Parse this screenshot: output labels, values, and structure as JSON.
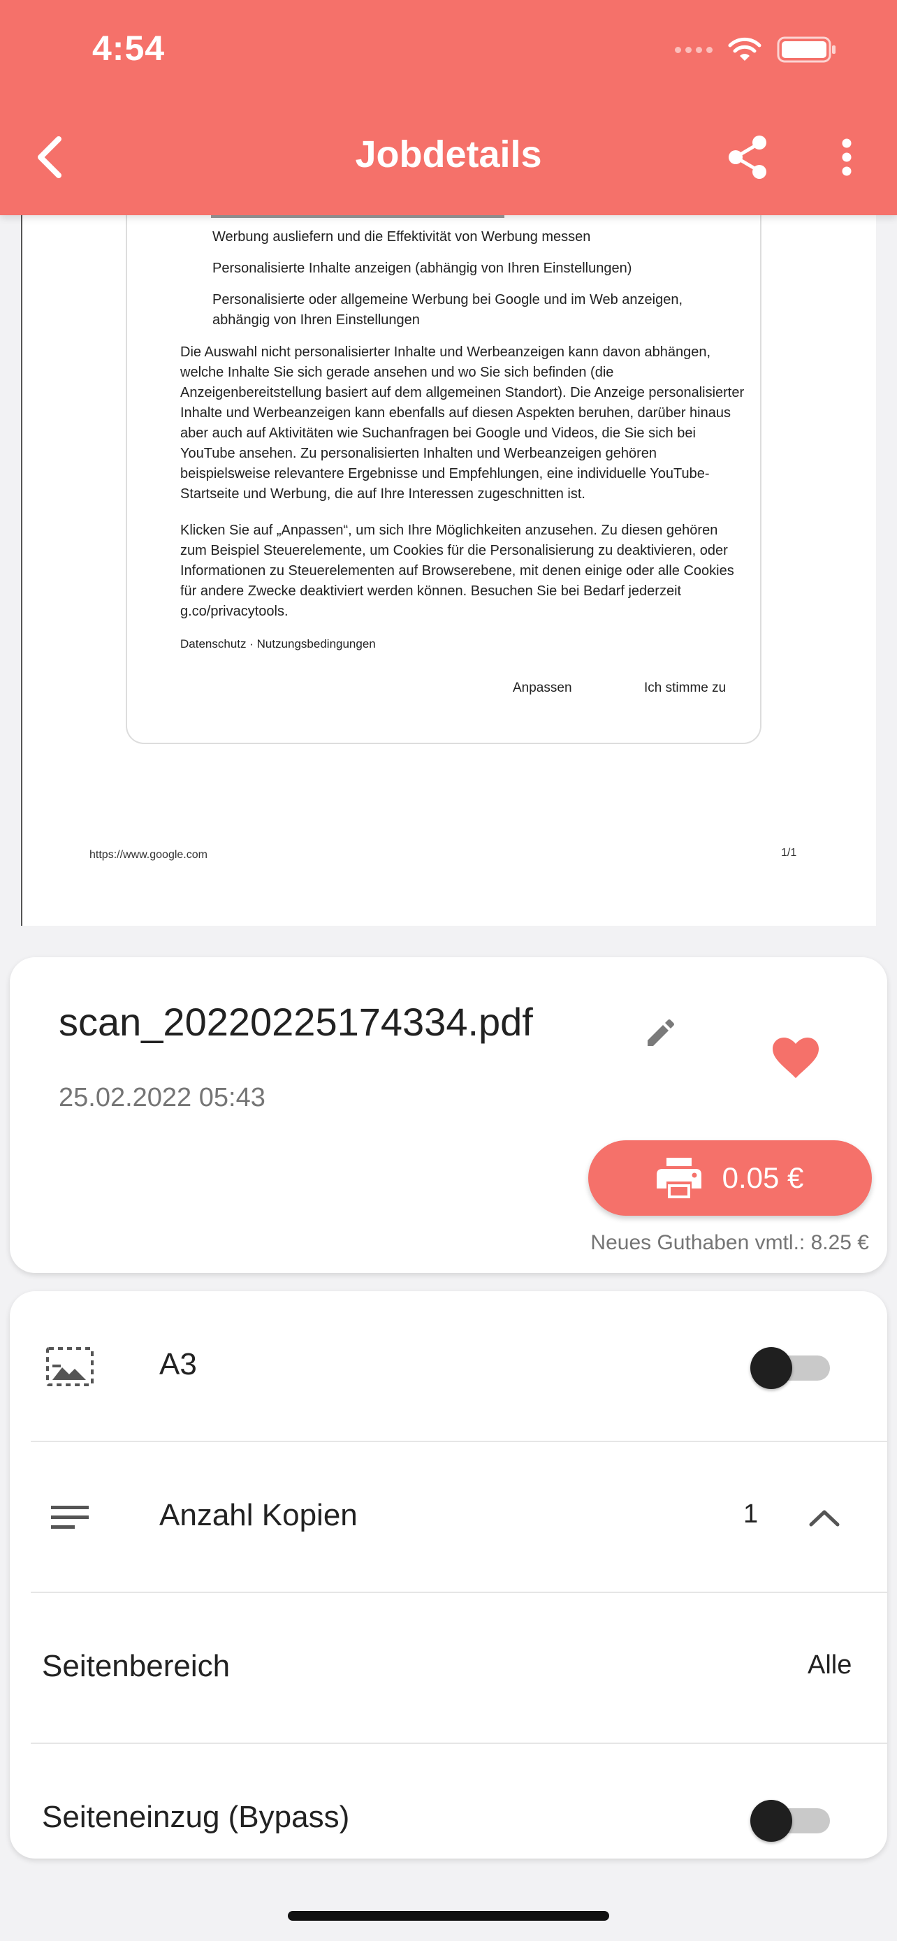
{
  "status_bar": {
    "time": "4:54"
  },
  "header": {
    "title": "Jobdetails"
  },
  "document": {
    "bullets": [
      "Werbung ausliefern und die Effektivität von Werbung messen",
      "Personalisierte Inhalte anzeigen (abhängig von Ihren Einstellungen)",
      "Personalisierte oder allgemeine Werbung bei Google und im Web anzeigen, abhängig von Ihren Einstellungen"
    ],
    "paragraph1": "Die Auswahl nicht personalisierter Inhalte und Werbeanzeigen kann davon abhängen, welche Inhalte Sie sich gerade ansehen und wo Sie sich befinden (die Anzeigenbereitstellung basiert auf dem allgemeinen Standort). Die Anzeige personalisierter Inhalte und Werbeanzeigen kann ebenfalls auf diesen Aspekten beruhen, darüber hinaus aber auch auf Aktivitäten wie Suchanfragen bei Google und Videos, die Sie sich bei YouTube ansehen. Zu personalisierten Inhalten und Werbeanzeigen gehören beispielsweise relevantere Ergebnisse und Empfehlungen, eine individuelle YouTube-Startseite und Werbung, die auf Ihre Interessen zugeschnitten ist.",
    "paragraph2": "Klicken Sie auf „Anpassen“, um sich Ihre Möglichkeiten anzusehen. Zu diesen gehören zum Beispiel Steuerelemente, um Cookies für die Personalisierung zu deaktivieren, oder Informationen zu Steuerelementen auf Browserebene, mit denen einige oder alle Cookies für andere Zwecke deaktiviert werden können. Besuchen Sie bei Bedarf jederzeit g.co/privacytools.",
    "links": "Datenschutz  ·  Nutzungsbedingungen",
    "button_customize": "Anpassen",
    "button_agree": "Ich stimme zu",
    "url": "https://www.google.com",
    "page": "1/1"
  },
  "file": {
    "name": "scan_20220225174334.pdf",
    "date": "25.02.2022 05:43",
    "price": "0.05 €",
    "balance": "Neues Guthaben vmtl.: 8.25 €"
  },
  "settings": {
    "a3_label": "A3",
    "copies_label": "Anzahl Kopien",
    "copies_value": "1",
    "page_range_label": "Seitenbereich",
    "page_range_value": "Alle",
    "bypass_label": "Seiteneinzug (Bypass)"
  },
  "colors": {
    "accent": "#f5716a",
    "background": "#f2f2f4"
  }
}
